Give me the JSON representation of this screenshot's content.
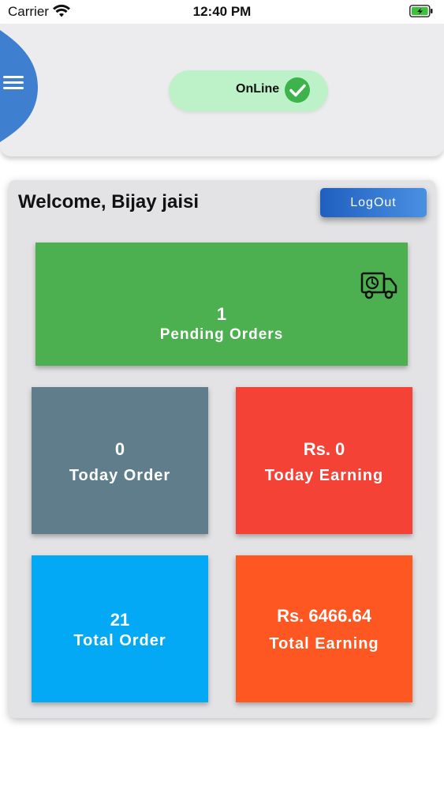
{
  "status_bar": {
    "carrier": "Carrier",
    "time": "12:40 PM"
  },
  "header": {
    "status_label": "OnLine"
  },
  "dashboard": {
    "welcome": "Welcome, Bijay jaisi",
    "logout_label": "LogOut",
    "pending": {
      "value": "1",
      "label": "Pending Orders"
    },
    "today_order": {
      "value": "0",
      "label": "Today Order"
    },
    "today_earning": {
      "value": "Rs. 0",
      "label": "Today Earning"
    },
    "total_order": {
      "value": "21",
      "label": "Total Order"
    },
    "total_earning": {
      "value": "Rs. 6466.64",
      "label": "Total Earning"
    }
  },
  "icons": [
    "wifi-icon",
    "battery-icon",
    "hamburger-menu-icon",
    "check-circle-icon",
    "delivery-truck-icon"
  ],
  "colors": {
    "online_pill": "#bdf2c8",
    "check": "#3cb44b",
    "logout": "#1f5fbf",
    "pending": "#4caf50",
    "today_order": "#607d8b",
    "today_earning": "#f44336",
    "total_order": "#03a9f4",
    "total_earning": "#ff5722",
    "menu_blob": "#3f7fcf"
  }
}
